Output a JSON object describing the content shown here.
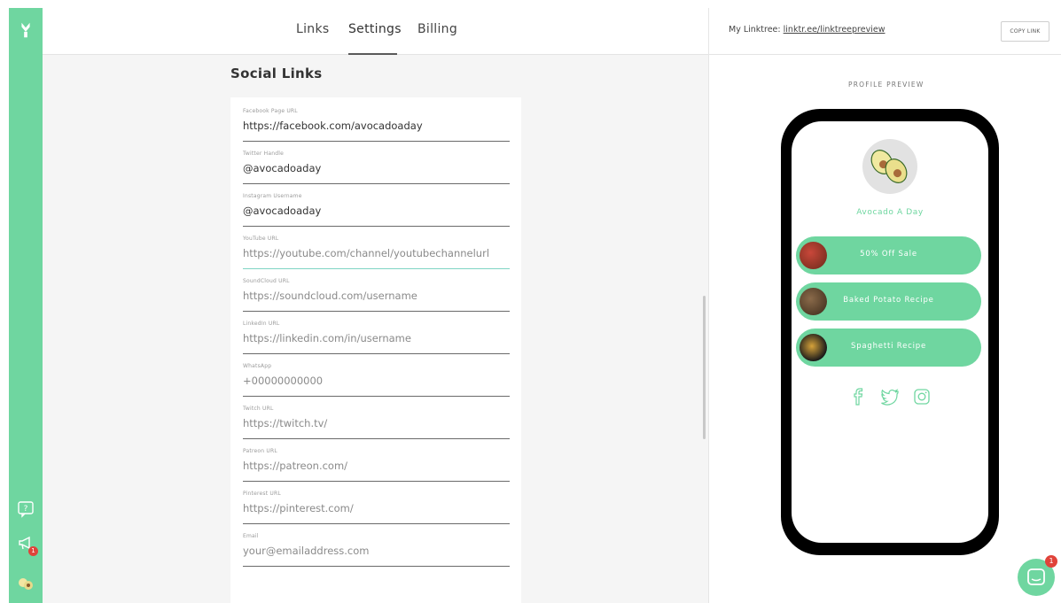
{
  "nav": {
    "tabs": [
      {
        "label": "Links"
      },
      {
        "label": "Settings"
      },
      {
        "label": "Billing"
      }
    ],
    "active_tab": "Settings"
  },
  "rail": {
    "help_icon": "help-icon",
    "announce_icon": "megaphone-icon",
    "announce_badge": "1",
    "avatar_icon": "avocado-icon"
  },
  "social": {
    "title": "Social Links",
    "fields": [
      {
        "label": "Facebook Page URL",
        "value": "https://facebook.com/avocadoaday",
        "placeholder": ""
      },
      {
        "label": "Twitter Handle",
        "value": "@avocadoaday",
        "placeholder": ""
      },
      {
        "label": "Instagram Username",
        "value": "@avocadoaday",
        "placeholder": ""
      },
      {
        "label": "YouTube URL",
        "value": "",
        "placeholder": "https://youtube.com/channel/youtubechannelurl"
      },
      {
        "label": "SoundCloud URL",
        "value": "",
        "placeholder": "https://soundcloud.com/username"
      },
      {
        "label": "LinkedIn URL",
        "value": "",
        "placeholder": "https://linkedin.com/in/username"
      },
      {
        "label": "WhatsApp",
        "value": "",
        "placeholder": "+00000000000"
      },
      {
        "label": "Twitch URL",
        "value": "",
        "placeholder": "https://twitch.tv/"
      },
      {
        "label": "Patreon URL",
        "value": "",
        "placeholder": "https://patreon.com/"
      },
      {
        "label": "Pinterest URL",
        "value": "",
        "placeholder": "https://pinterest.com/"
      },
      {
        "label": "Email",
        "value": "",
        "placeholder": "your@emailaddress.com"
      }
    ]
  },
  "header_right": {
    "my_linktree_label": "My Linktree:",
    "my_linktree_url": "linktr.ee/linktreepreview",
    "copy_label": "COPY LINK"
  },
  "preview": {
    "label": "PROFILE PREVIEW",
    "profile_name": "Avocado A Day",
    "links": [
      {
        "title": "50% Off Sale"
      },
      {
        "title": "Baked Potato Recipe"
      },
      {
        "title": "Spaghetti Recipe"
      }
    ]
  },
  "chat": {
    "badge": "1"
  },
  "colors": {
    "brand_green": "#6fd6a0",
    "badge_red": "#e0433a",
    "focus_teal": "#7fd4c4"
  }
}
